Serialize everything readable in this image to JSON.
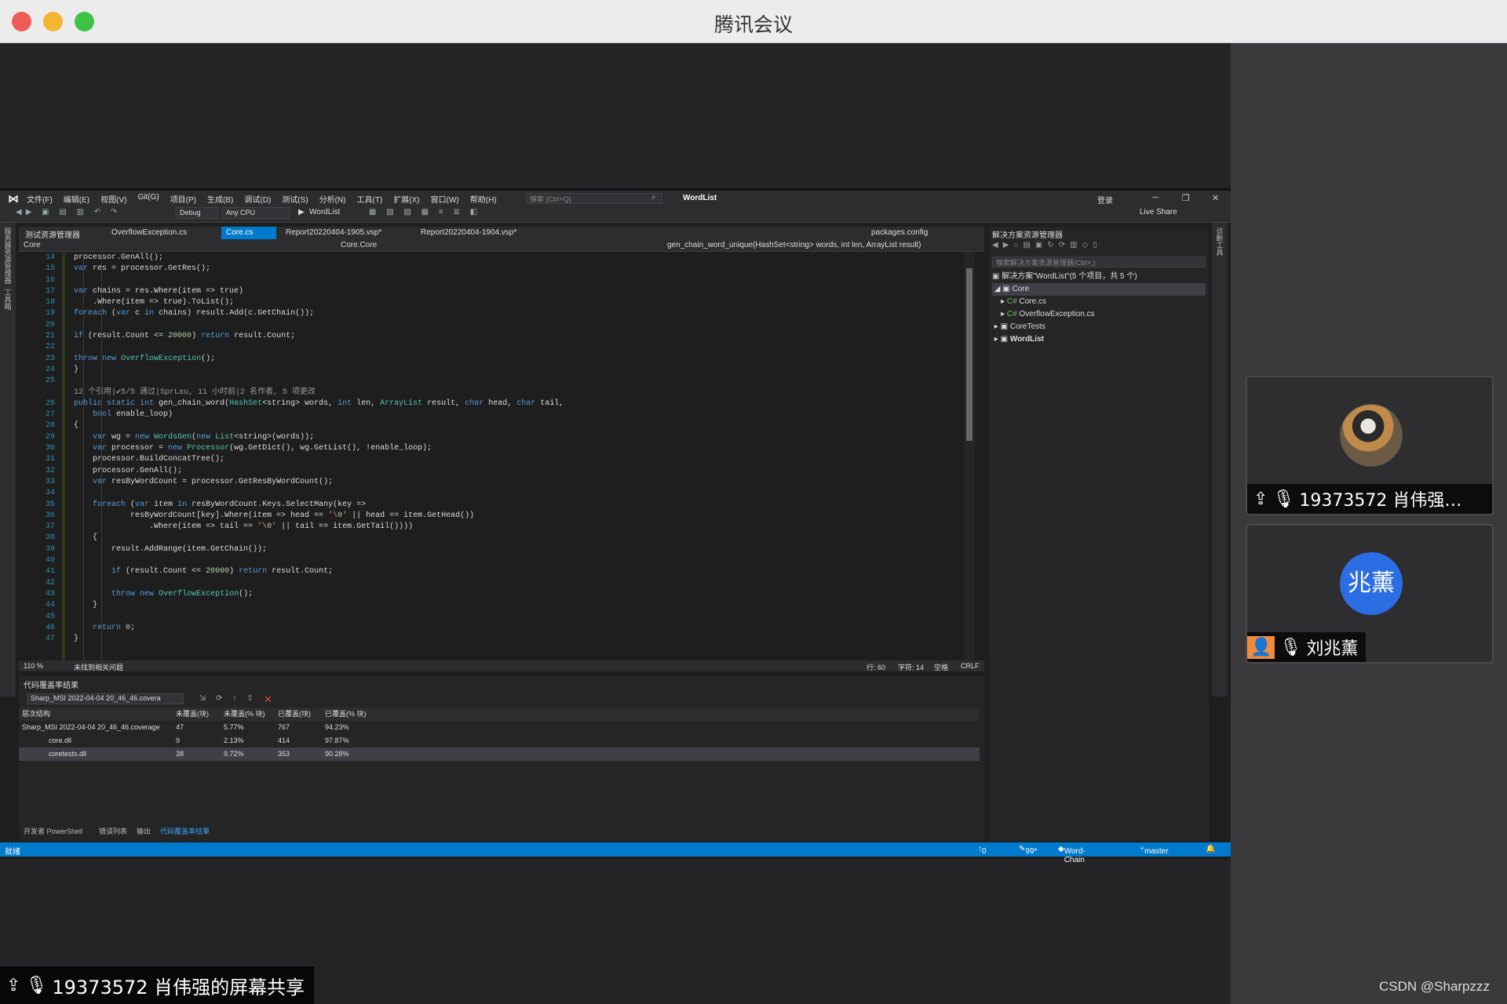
{
  "window": {
    "title": "腾讯会议"
  },
  "vs": {
    "menu": [
      "文件(F)",
      "编辑(E)",
      "视图(V)",
      "Git(G)",
      "项目(P)",
      "生成(B)",
      "调试(D)",
      "测试(S)",
      "分析(N)",
      "工具(T)",
      "扩展(X)",
      "窗口(W)",
      "帮助(H)"
    ],
    "search_placeholder": "搜索 (Ctrl+Q)",
    "solution_name": "WordList",
    "signin": "登录",
    "toolbar": {
      "config": "Debug",
      "platform": "Any CPU",
      "run_label": "WordList",
      "live_share": "Live Share"
    },
    "left_strip": [
      "服务器资源管理器",
      "工具箱"
    ],
    "right_strip": [
      "诊断工具"
    ],
    "tabs": [
      {
        "label": "测试资源管理器"
      },
      {
        "label": "OverflowException.cs"
      },
      {
        "label": "Core.cs"
      },
      {
        "label": "Report20220404-1905.vsp*"
      },
      {
        "label": "Report20220404-1904.vsp*"
      },
      {
        "label": "packages.config"
      }
    ],
    "nav": {
      "project": "Core",
      "type": "Core.Core",
      "member": "gen_chain_word_unique(HashSet<string> words, int len, ArrayList result)"
    },
    "line_numbers": [
      "14",
      "15",
      "16",
      "17",
      "18",
      "19",
      "20",
      "21",
      "22",
      "23",
      "24",
      "25",
      "",
      "26",
      "27",
      "28",
      "29",
      "30",
      "31",
      "32",
      "33",
      "34",
      "35",
      "36",
      "37",
      "38",
      "39",
      "40",
      "41",
      "42",
      "43",
      "44",
      "45",
      "46",
      "47"
    ],
    "code_lines": [
      "processor.GenAll();",
      "var res = processor.GetRes();",
      "",
      "var chains = res.Where(item => true)",
      "    .Where(item => true).ToList();",
      "foreach (var c in chains) result.Add(c.GetChain());",
      "",
      "if (result.Count <= 20000) return result.Count;",
      "",
      "throw new OverflowException();",
      "}",
      "",
      "12 个引用|✔5/5 通过|SprLau, 11 小时前|2 名作者, 5 项更改",
      "public static int gen_chain_word(HashSet<string> words, int len, ArrayList result, char head, char tail,",
      "    bool enable_loop)",
      "{",
      "    var wg = new WordsGen(new List<string>(words));",
      "    var processor = new Processor(wg.GetDict(), wg.GetList(), !enable_loop);",
      "    processor.BuildConcatTree();",
      "    processor.GenAll();",
      "    var resByWordCount = processor.GetResByWordCount();",
      "",
      "    foreach (var item in resByWordCount.Keys.SelectMany(key =>",
      "            resByWordCount[key].Where(item => head == '\\0' || head == item.GetHead())",
      "                .Where(item => tail == '\\0' || tail == item.GetTail())))",
      "    {",
      "        result.AddRange(item.GetChain());",
      "",
      "        if (result.Count <= 20000) return result.Count;",
      "",
      "        throw new OverflowException();",
      "    }",
      "",
      "    return 0;",
      "}"
    ],
    "editor_status": {
      "zoom": "110 %",
      "issues": "未找到相关问题",
      "line": "行: 60",
      "col": "字符: 14",
      "space": "空格",
      "eol": "CRLF"
    },
    "coverage": {
      "title": "代码覆盖率结果",
      "selector": "Sharp_MSI 2022-04-04 20_46_46.covera",
      "headers": [
        "层次结构",
        "未覆盖(块)",
        "未覆盖(% 块)",
        "已覆盖(块)",
        "已覆盖(% 块)"
      ],
      "rows": [
        {
          "name": "Sharp_MSI 2022-04-04 20_46_46.coverage",
          "nc": "47",
          "ncp": "5.77%",
          "c": "767",
          "cp": "94.23%"
        },
        {
          "name": "core.dll",
          "nc": "9",
          "ncp": "2.13%",
          "c": "414",
          "cp": "97.87%"
        },
        {
          "name": "coretests.dll",
          "nc": "38",
          "ncp": "9.72%",
          "c": "353",
          "cp": "90.28%"
        }
      ]
    },
    "bottom_tabs": [
      "开发者 PowerShell",
      "错误列表",
      "输出",
      "代码覆盖率结果"
    ],
    "statusbar": {
      "ready": "就绪",
      "up": "0",
      "pencil": "99*",
      "repo": "Word-Chain",
      "branch": "master"
    },
    "solution_explorer": {
      "title": "解决方案资源管理器",
      "search_placeholder": "搜索解决方案资源管理器(Ctrl+;)",
      "root": "解决方案\"WordList\"(5 个项目，共 5 个)",
      "items": [
        "Core",
        "Core.cs",
        "OverflowException.cs",
        "CoreTests",
        "WordList"
      ]
    }
  },
  "participants": [
    {
      "label": "19373572 肖伟强…"
    },
    {
      "initials": "兆薰",
      "label": "刘兆薰"
    }
  ],
  "screen_share_label": "19373572 肖伟强的屏幕共享",
  "watermark": "CSDN @Sharpzzz"
}
